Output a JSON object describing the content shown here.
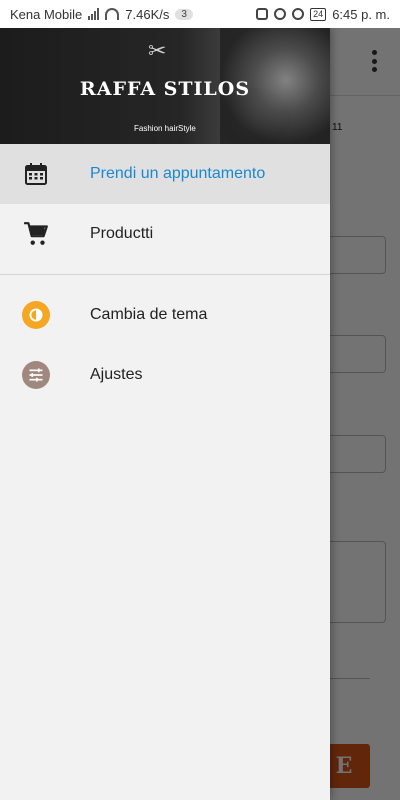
{
  "status_bar": {
    "carrier": "Kena Mobile",
    "speed": "7.46K/s",
    "notif_count": "3",
    "battery": "24",
    "time": "6:45 p. m."
  },
  "background_app": {
    "small_text": "11",
    "button_letter": "E"
  },
  "drawer": {
    "header": {
      "brand": "RAFFA STILOS",
      "tagline": "Fashion hairStyle"
    },
    "items": [
      {
        "label": "Prendi un appuntamento",
        "icon": "calendar-icon",
        "active": true
      },
      {
        "label": "Productti",
        "icon": "cart-icon",
        "active": false
      }
    ],
    "secondary_items": [
      {
        "label": "Cambia de tema",
        "icon": "theme-icon",
        "color": "#f5a623"
      },
      {
        "label": "Ajustes",
        "icon": "settings-sliders-icon",
        "color": "#a1887f"
      }
    ]
  },
  "colors": {
    "active_text": "#1a88d0",
    "drawer_bg": "#f2f2f2",
    "accent_button": "#d9541a"
  }
}
